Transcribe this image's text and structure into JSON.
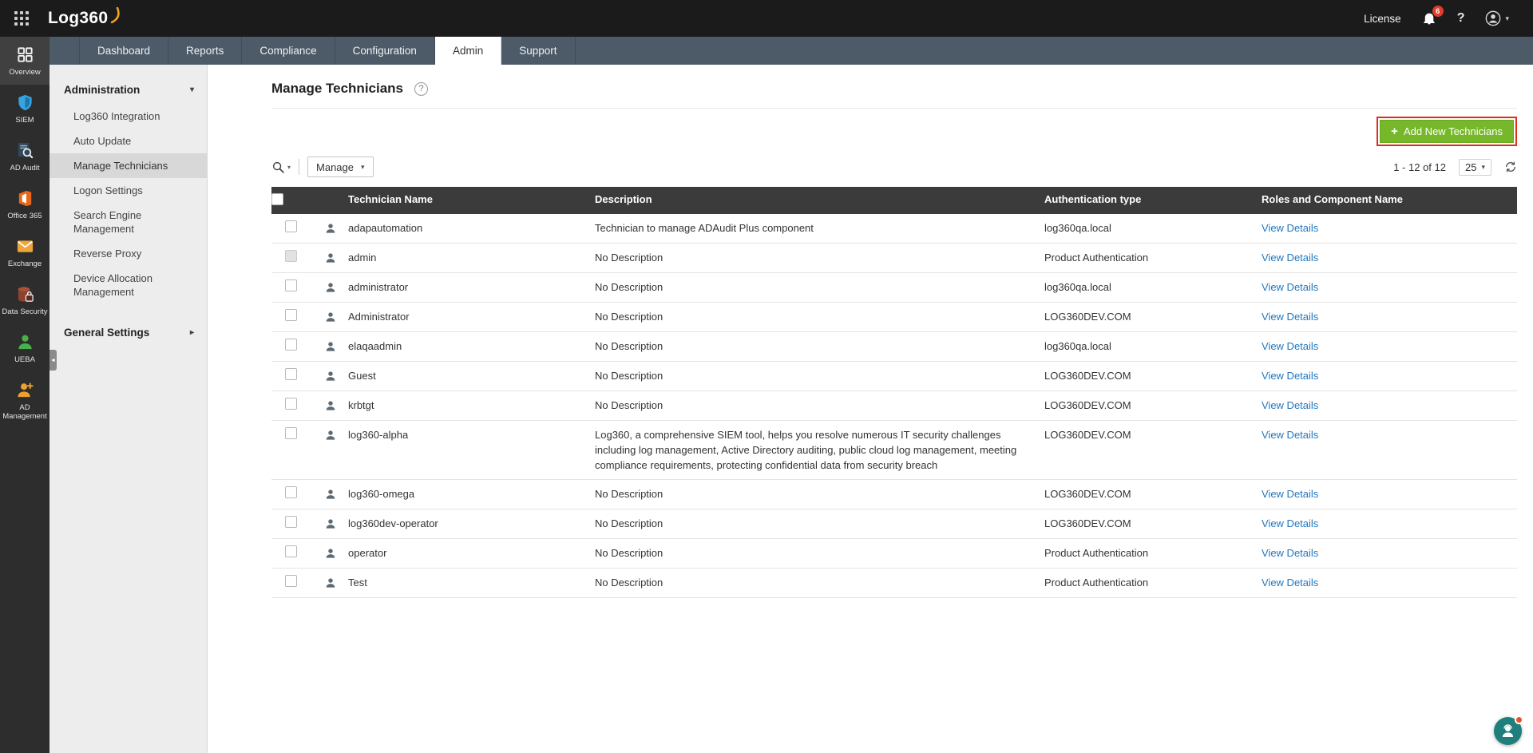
{
  "topbar": {
    "logo_text": "Log360",
    "license_label": "License",
    "notification_count": "6",
    "help_label": "?"
  },
  "nav": {
    "tabs": [
      {
        "label": "Dashboard",
        "active": false
      },
      {
        "label": "Reports",
        "active": false
      },
      {
        "label": "Compliance",
        "active": false
      },
      {
        "label": "Configuration",
        "active": false
      },
      {
        "label": "Admin",
        "active": true
      },
      {
        "label": "Support",
        "active": false
      }
    ]
  },
  "rail": {
    "items": [
      {
        "label": "Overview",
        "icon": "overview-icon",
        "active": true
      },
      {
        "label": "SIEM",
        "icon": "siem-icon",
        "active": false
      },
      {
        "label": "AD Audit",
        "icon": "ad-audit-icon",
        "active": false
      },
      {
        "label": "Office 365",
        "icon": "office365-icon",
        "active": false
      },
      {
        "label": "Exchange",
        "icon": "exchange-icon",
        "active": false
      },
      {
        "label": "Data Security",
        "icon": "data-security-icon",
        "active": false
      },
      {
        "label": "UEBA",
        "icon": "ueba-icon",
        "active": false
      },
      {
        "label": "AD Management",
        "icon": "ad-management-icon",
        "active": false
      }
    ]
  },
  "sidebar": {
    "section_label": "Administration",
    "items": [
      {
        "label": "Log360 Integration",
        "selected": false
      },
      {
        "label": "Auto Update",
        "selected": false
      },
      {
        "label": "Manage Technicians",
        "selected": true
      },
      {
        "label": "Logon Settings",
        "selected": false
      },
      {
        "label": "Search Engine Management",
        "selected": false
      },
      {
        "label": "Reverse Proxy",
        "selected": false
      },
      {
        "label": "Device Allocation Management",
        "selected": false
      }
    ],
    "footer_label": "General Settings"
  },
  "main": {
    "title": "Manage Technicians",
    "add_button_label": "Add New Technicians",
    "toolbar": {
      "manage_label": "Manage",
      "pagination": "1 - 12 of 12",
      "page_size": "25"
    },
    "table": {
      "columns": [
        "Technician Name",
        "Description",
        "Authentication type",
        "Roles and Component Name"
      ],
      "view_details_label": "View Details",
      "rows": [
        {
          "name": "adapautomation",
          "description": "Technician to manage ADAudit Plus component",
          "auth_type": "log360qa.local"
        },
        {
          "name": "admin",
          "description": "No Description",
          "auth_type": "Product Authentication",
          "checkbox_disabled": true
        },
        {
          "name": "administrator",
          "description": "No Description",
          "auth_type": "log360qa.local"
        },
        {
          "name": "Administrator",
          "description": "No Description",
          "auth_type": "LOG360DEV.COM"
        },
        {
          "name": "elaqaadmin",
          "description": "No Description",
          "auth_type": "log360qa.local"
        },
        {
          "name": "Guest",
          "description": "No Description",
          "auth_type": "LOG360DEV.COM"
        },
        {
          "name": "krbtgt",
          "description": "No Description",
          "auth_type": "LOG360DEV.COM"
        },
        {
          "name": "log360-alpha",
          "description": "Log360, a comprehensive SIEM tool, helps you resolve numerous IT security challenges including log management, Active Directory auditing, public cloud log management, meeting compliance requirements, protecting confidential data from security breach",
          "auth_type": "LOG360DEV.COM"
        },
        {
          "name": "log360-omega",
          "description": "No Description",
          "auth_type": "LOG360DEV.COM"
        },
        {
          "name": "log360dev-operator",
          "description": "No Description",
          "auth_type": "LOG360DEV.COM"
        },
        {
          "name": "operator",
          "description": "No Description",
          "auth_type": "Product Authentication"
        },
        {
          "name": "Test",
          "description": "No Description",
          "auth_type": "Product Authentication"
        }
      ]
    }
  },
  "colors": {
    "accent_green": "#76b82a",
    "annotation_red": "#e02b1e",
    "link_blue": "#2278bf",
    "table_header_bg": "#3b3b3b"
  }
}
